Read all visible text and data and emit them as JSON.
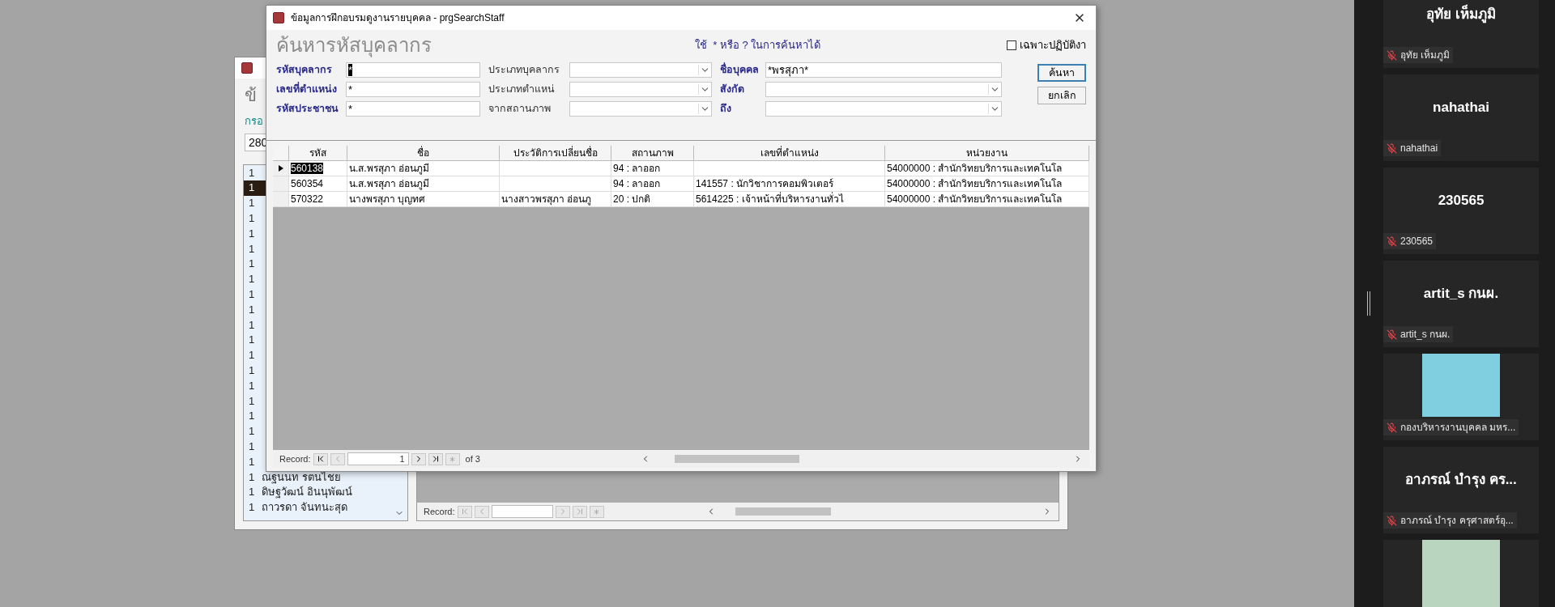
{
  "background_window": {
    "heading": "ข้",
    "label": "กรอ",
    "field_value": "280",
    "record_label": "Record:",
    "list": [
      {
        "number": "1",
        "selected": false
      },
      {
        "number": "1",
        "selected": true
      },
      {
        "number": "1",
        "selected": false
      },
      {
        "number": "1",
        "selected": false
      },
      {
        "number": "1",
        "selected": false
      },
      {
        "number": "1",
        "selected": false
      },
      {
        "number": "1",
        "selected": false
      },
      {
        "number": "1",
        "selected": false
      },
      {
        "number": "1",
        "selected": false
      },
      {
        "number": "1",
        "selected": false
      },
      {
        "number": "1",
        "selected": false
      },
      {
        "number": "1",
        "selected": false
      },
      {
        "number": "1",
        "selected": false
      },
      {
        "number": "1",
        "selected": false
      },
      {
        "number": "1",
        "selected": false
      },
      {
        "number": "1",
        "selected": false
      },
      {
        "number": "1",
        "selected": false
      },
      {
        "number": "1",
        "selected": false
      },
      {
        "number": "1",
        "selected": false
      },
      {
        "number": "1",
        "selected": false
      },
      {
        "number": "1",
        "name": "ณฐนนท รตนไชย",
        "selected": false
      },
      {
        "number": "1",
        "name": "ดิษฐวัฒน์ อินนุพัฒน์",
        "selected": false
      },
      {
        "number": "1",
        "name": "ถาวรดา จันทนะสุด",
        "selected": false
      }
    ]
  },
  "dialog": {
    "title": "ข้อมูลการฝึกอบรมดูงานรายบุคคล - prgSearchStaff",
    "heading": "ค้นหารหัสบุคลากร",
    "hint": "ใช้  * หรือ ? ในการค้นหาได้",
    "checkbox": {
      "label": "เฉพาะปฏิบัติงา",
      "checked": false
    },
    "field_columns": [
      [
        {
          "label": "รหัสบุคลากร",
          "kind": "text",
          "value": "*",
          "text_selected": true
        },
        {
          "label": "เลขที่ตำแหน่ง",
          "kind": "text",
          "value": "*",
          "text_selected": false
        },
        {
          "label": "รหัสประชาชน",
          "kind": "text",
          "value": "*",
          "text_selected": false
        }
      ],
      [
        {
          "label": "ประเภทบุคลากร",
          "kind": "combo"
        },
        {
          "label": "ประเภทตำแหน่",
          "kind": "combo"
        },
        {
          "label": "จากสถานภาพ",
          "kind": "combo"
        }
      ],
      [
        {
          "label": "ชื่อบุคคล",
          "kind": "text",
          "value": "*พรสุภา*",
          "text_selected": false
        },
        {
          "label": "สังกัด",
          "kind": "combo"
        },
        {
          "label": "ถึง",
          "kind": "combo"
        }
      ]
    ],
    "buttons": [
      {
        "label": "ค้นหา",
        "focused": true
      },
      {
        "label": "ยกเลิก",
        "focused": false
      }
    ],
    "table": {
      "columns": [
        "รหัส",
        "ชื่อ",
        "ประวัติการเปลี่ยนชื่อ",
        "สถานภาพ",
        "เลขที่ตำแหน่ง",
        "หน่วยงาน"
      ],
      "rows": [
        {
          "selected": true,
          "cells": [
            "560138",
            "น.ส.พรสุภา อ่อนภูมี",
            "",
            "94 : ลาออก",
            "",
            "54000000 : สำนักวิทยบริการและเทคโนโล"
          ]
        },
        {
          "selected": false,
          "cells": [
            "560354",
            "น.ส.พรสุภา อ่อนภูมี",
            "",
            "94 : ลาออก",
            "141557 : นักวิชาการคอมพิวเตอร์",
            "54000000 : สำนักวิทยบริการและเทคโนโล"
          ]
        },
        {
          "selected": false,
          "cells": [
            "570322",
            "นางพรสุภา บุญทศ",
            "นางสาวพรสุภา อ่อนภู",
            "20 : ปกติ",
            "5614225 : เจ้าหน้าที่บริหารงานทั่วไ",
            "54000000 : สำนักวิทยบริการและเทคโนโล"
          ]
        }
      ]
    },
    "record_bar": {
      "label": "Record:",
      "current": "1",
      "total": "of 3"
    }
  },
  "participants": [
    {
      "kind": "name",
      "display_name": "อุทัย เห็มภูมิ",
      "label": "อุทัย เห็มภูมิ"
    },
    {
      "kind": "name",
      "display_name": "nahathai",
      "label": "nahathai"
    },
    {
      "kind": "name",
      "display_name": "230565",
      "label": "230565"
    },
    {
      "kind": "name",
      "display_name": "artit_s กนผ.",
      "label": "artit_s กนผ."
    },
    {
      "kind": "logo",
      "label": "กองบริหารงานบุคคล มหร..."
    },
    {
      "kind": "name",
      "display_name": "อาภรณ์ บำรุง คร...",
      "label": "อาภรณ์ บำรุง ครุศาสตร์อุ..."
    },
    {
      "kind": "photo"
    }
  ]
}
